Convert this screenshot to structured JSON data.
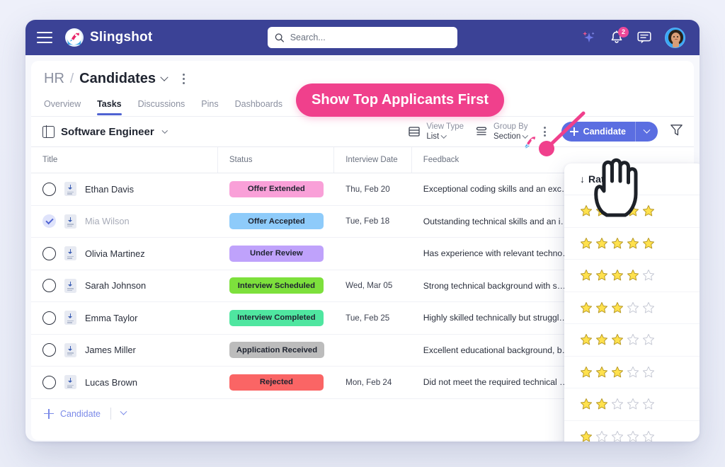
{
  "navbar": {
    "brand": "Slingshot",
    "menu_icon": "hamburger-icon",
    "search": {
      "placeholder": "Search...",
      "value": ""
    },
    "ai_icon": "sparkle-icon",
    "notifications": {
      "icon": "bell-icon",
      "count": "2"
    },
    "chat_icon": "chat-icon",
    "avatar": "user-avatar"
  },
  "page": {
    "breadcrumb_parent": "HR",
    "breadcrumb_separator": "/",
    "breadcrumb_current": "Candidates",
    "tabs": [
      {
        "label": "Overview",
        "active": false
      },
      {
        "label": "Tasks",
        "active": true
      },
      {
        "label": "Discussions",
        "active": false
      },
      {
        "label": "Pins",
        "active": false
      },
      {
        "label": "Dashboards",
        "active": false
      }
    ],
    "edit_icon": "pencil-icon"
  },
  "callout": {
    "text": "Show Top Applicants First",
    "color": "#f0408c"
  },
  "toolbar": {
    "section_name": "Software Engineer",
    "view_type": {
      "label": "View Type",
      "value": "List"
    },
    "group_by": {
      "label": "Group By",
      "value": "Section"
    },
    "add_button": "Candidate",
    "filter_icon": "filter-icon",
    "more_icon": "kebab-menu-icon"
  },
  "table": {
    "columns": [
      "Title",
      "Status",
      "Interview Date",
      "Feedback"
    ],
    "rating_column": {
      "label": "Rating",
      "sort": "descending",
      "sort_glyph": "↓"
    },
    "rows": [
      {
        "name": "Ethan Davis",
        "checked": false,
        "status": "Offer Extended",
        "status_color": "#f9a0d8",
        "date": "Thu, Feb 20",
        "feedback": "Exceptional coding skills and an exc…",
        "rating": 5
      },
      {
        "name": "Mia Wilson",
        "checked": true,
        "status": "Offer Accepted",
        "status_color": "#8ecbfa",
        "date": "Tue, Feb 18",
        "feedback": "Outstanding technical skills and an i…",
        "rating": 5
      },
      {
        "name": "Olivia Martinez",
        "checked": false,
        "status": "Under Review",
        "status_color": "#bfa2fb",
        "date": "",
        "feedback": "Has experience with relevant techno…",
        "rating": 4
      },
      {
        "name": "Sarah Johnson",
        "checked": false,
        "status": "Interview Scheduled",
        "status_color": "#7de03c",
        "date": "Wed, Mar 05",
        "feedback": "Strong technical background with s…",
        "rating": 3
      },
      {
        "name": "Emma Taylor",
        "checked": false,
        "status": "Interview Completed",
        "status_color": "#4fe6a0",
        "date": "Tue, Feb 25",
        "feedback": "Highly skilled technically but struggl…",
        "rating": 3
      },
      {
        "name": "James Miller",
        "checked": false,
        "status": "Application Received",
        "status_color": "#bcbcbc",
        "date": "",
        "feedback": "Excellent educational background, b…",
        "rating": 3
      },
      {
        "name": "Lucas Brown",
        "checked": false,
        "status": "Rejected",
        "status_color": "#fa6565",
        "date": "Mon, Feb 24",
        "feedback": "Did not meet the required technical …",
        "rating": 2
      }
    ],
    "extra_rating_row": {
      "rating": 1
    },
    "add_row": {
      "label": "Candidate",
      "icon": "plus-icon",
      "chevron": "chevron-down-icon"
    },
    "add_column_icon": "plus-icon",
    "row_menu_icon": "kebab-menu-icon"
  },
  "colors": {
    "navbar": "#3b4296",
    "accent": "#5b6ee1",
    "callout": "#f0408c",
    "star_filled": "#ffe14d",
    "star_empty": "#ffffff"
  }
}
